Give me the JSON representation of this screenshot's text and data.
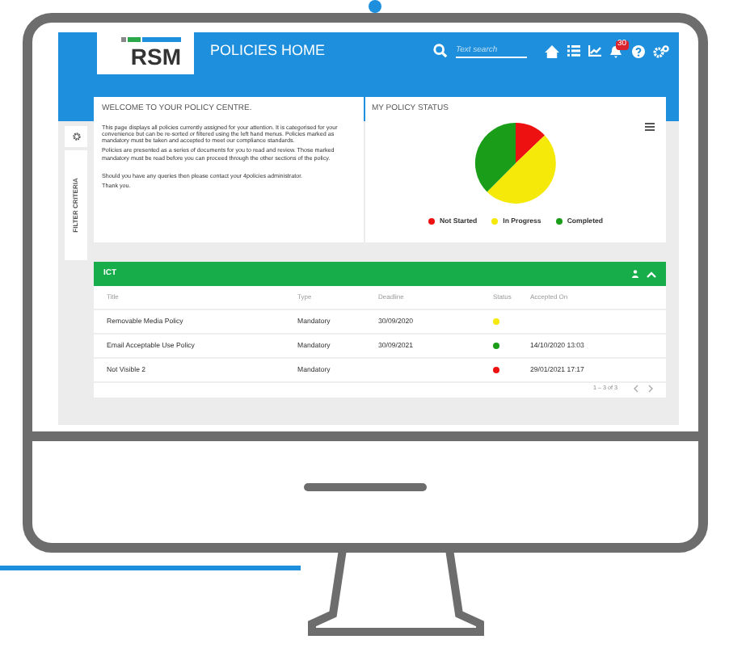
{
  "header": {
    "logo": "RSM",
    "title": "POLICIES HOME",
    "search": {
      "placeholder": "Text search"
    },
    "notification_badge": "30"
  },
  "side_tab": {
    "label": "FILTER CRITERIA"
  },
  "welcome": {
    "title": "WELCOME TO YOUR POLICY CENTRE.",
    "paragraphs": [
      "This page displays all policies currently assigned for your attention. It is categorised for your convenience but can be re-sorted or filtered using the left hand menus. Policies marked as mandatory must be taken and accepted to meet our compliance standards.",
      "Policies are presented as a series of documents for you to read and review. Those marked mandatory must be read before you can proceed through the other sections of the policy.",
      "Should you have any queries then please contact your 4policies administrator.",
      "Thank you."
    ]
  },
  "status": {
    "title": "MY POLICY STATUS",
    "legend": [
      {
        "label": "Not Started",
        "color": "#ee1111"
      },
      {
        "label": "In Progress",
        "color": "#f5e90a"
      },
      {
        "label": "Completed",
        "color": "#1a9e1a"
      }
    ]
  },
  "group": {
    "title": "ICT",
    "columns": [
      "Title",
      "Type",
      "Deadline",
      "Status",
      "Accepted On"
    ],
    "rows": [
      {
        "title": "Removable Media Policy",
        "type": "Mandatory",
        "deadline": "30/09/2020",
        "color": "#f5e90a",
        "accepted": ""
      },
      {
        "title": "Email Acceptable Use Policy",
        "type": "Mandatory",
        "deadline": "30/09/2021",
        "color": "#1a9e1a",
        "accepted": "14/10/2020 13:03"
      },
      {
        "title": "Not Visible 2",
        "type": "Mandatory",
        "deadline": "",
        "color": "#ee1111",
        "accepted": "29/01/2021 17:17"
      }
    ],
    "pager": "1 – 3 of 3"
  }
}
